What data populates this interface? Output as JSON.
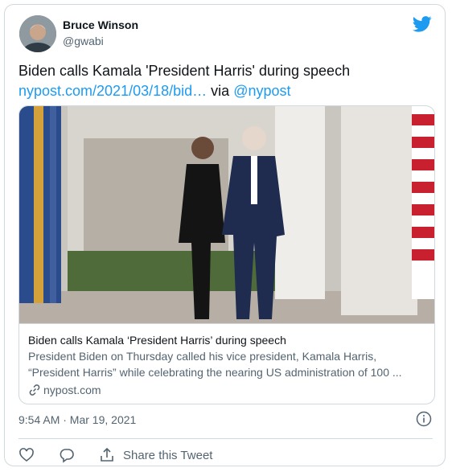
{
  "author": {
    "name": "Bruce Winson",
    "handle": "@gwabi"
  },
  "tweet": {
    "text": "Biden calls Kamala 'President Harris' during speech",
    "link_text": "nypost.com/2021/03/18/bid…",
    "via_text": "via",
    "mention": "@nypost"
  },
  "preview": {
    "title": "Biden calls Kamala ‘President Harris’ during speech",
    "description": "President Biden on Thursday called his vice president, Kamala Harris, “President Harris” while celebrating the nearing US administration of 100 ...",
    "domain": "nypost.com"
  },
  "timestamp": "9:54 AM · Mar 19, 2021",
  "actions": {
    "share_label": "Share this Tweet"
  },
  "icons": {
    "brand": "twitter-bird-icon",
    "info": "info-icon",
    "like": "heart-icon",
    "reply": "reply-icon",
    "share": "share-icon",
    "domain": "link-icon"
  },
  "colors": {
    "accent": "#1d9bf0",
    "muted": "#536471",
    "border": "#cfd9de",
    "text": "#0f1419"
  }
}
